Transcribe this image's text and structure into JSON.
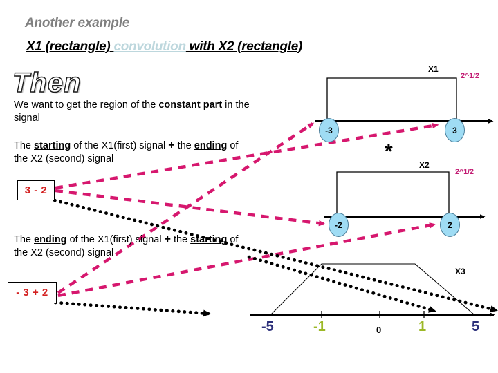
{
  "slide": {
    "subtitle": "Another example",
    "title_parts": [
      {
        "text": "X1 (rectangle) ",
        "style": "black"
      },
      {
        "text": "convolution",
        "style": "conv"
      },
      {
        "text": " with X2 (rectangle)",
        "style": "black"
      }
    ],
    "title_x1": "X1 (rectangle) ",
    "title_convolution": "convolution",
    "title_x2": " with X2 (rectangle)",
    "wordart": "Then"
  },
  "body": {
    "constant_p1": "We want to get the region of the ",
    "constant_bold": "constant part",
    "constant_p2": " in the signal",
    "start_p1": "The ",
    "start_u1": "starting",
    "start_p2": " of the X1(first) signal ",
    "start_plus": "+",
    "start_p3": " the ",
    "start_u2": "ending",
    "start_p4": " of the X2 (second) signal",
    "end_p1": "The ",
    "end_u1": "ending",
    "end_p2": " of the X1(first) signal ",
    "end_plus": "+",
    "end_p3": " the ",
    "end_u2": "starting",
    "end_p4": " of the X2 (second) signal"
  },
  "boxes": {
    "box_top": "3 - 2",
    "box_bottom": "- 3 + 2",
    "box_text_color": "#d32020"
  },
  "signals": {
    "x1": {
      "name": "X1",
      "amplitude": "2^1/2",
      "left_marker": "-3",
      "right_marker": "3"
    },
    "x2": {
      "name": "X2",
      "amplitude": "2^1/2",
      "left_marker": "-2",
      "right_marker": "2"
    },
    "x3": {
      "name": "X3"
    },
    "operator": "*"
  },
  "axis_ticks": [
    {
      "label": "-5",
      "color": "#2b2f7a"
    },
    {
      "label": "-1",
      "color": "#9cb826"
    },
    {
      "label": "0",
      "color": "#000000"
    },
    {
      "label": "1",
      "color": "#9cb826"
    },
    {
      "label": "5",
      "color": "#2b2f7a"
    }
  ],
  "colors": {
    "pink_arrow": "#d6176e",
    "black_arrow": "#000000",
    "marker_fill": "#9fdcf4",
    "subtitle_gray": "#808080",
    "convolution_blue": "#bdd7dd"
  }
}
